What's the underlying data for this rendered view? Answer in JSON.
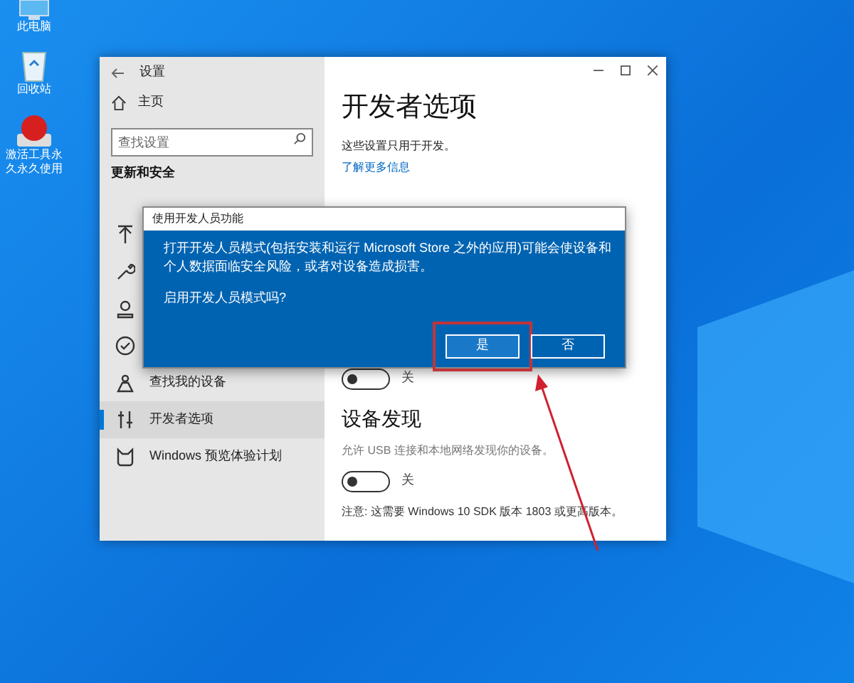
{
  "desktop_icons": [
    {
      "kind": "pc",
      "label": "此电脑"
    },
    {
      "kind": "bin",
      "label": "回收站"
    },
    {
      "kind": "tool",
      "label": "激活工具永久永久使用"
    }
  ],
  "window": {
    "title": "设置"
  },
  "sidebar": {
    "home": "主页",
    "search": {
      "placeholder": "查找设置"
    },
    "section": "更新和安全",
    "items": [
      {
        "kind": "backup",
        "selected": false
      },
      {
        "kind": "wrench",
        "selected": false
      },
      {
        "kind": "recover",
        "selected": false
      },
      {
        "kind": "check",
        "selected": false
      },
      {
        "kind": "find",
        "label": "查找我的设备",
        "selected": false
      },
      {
        "kind": "dev",
        "label": "开发者选项",
        "selected": true
      },
      {
        "kind": "insider",
        "label": "Windows 预览体验计划",
        "selected": false
      }
    ]
  },
  "content": {
    "title": "开发者选项",
    "subtitle": "这些设置只用于开发。",
    "link": "了解更多信息",
    "toggle_1": {
      "on": false,
      "label": "关"
    },
    "section": "设备发现",
    "section_desc": "允许 USB 连接和本地网络发现你的设备。",
    "toggle_2": {
      "on": false,
      "label": "关"
    },
    "note": "注意: 这需要 Windows 10 SDK 版本 1803 或更高版本。"
  },
  "dialog": {
    "title": "使用开发人员功能",
    "message": "打开开发人员模式(包括安装和运行 Microsoft Store 之外的应用)可能会使设备和个人数据面临安全风险，或者对设备造成损害。",
    "question": "启用开发人员模式吗?",
    "buttons": [
      {
        "label": "是",
        "highlighted": true
      },
      {
        "label": "否",
        "highlighted": false
      }
    ]
  }
}
